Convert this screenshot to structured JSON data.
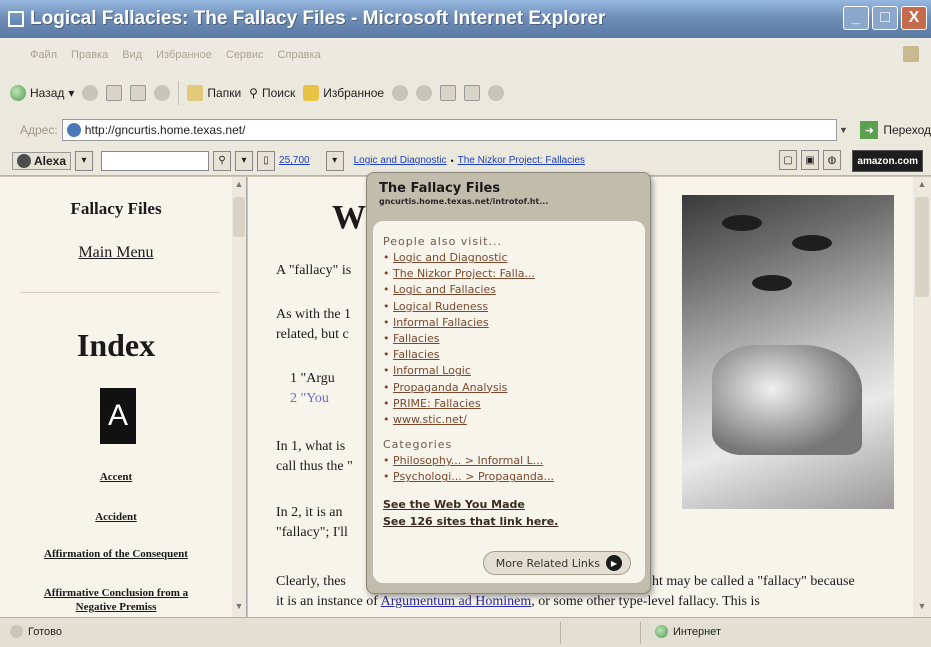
{
  "window": {
    "title": "Logical Fallacies: The Fallacy Files - Microsoft Internet Explorer",
    "buttons": [
      "_",
      "□",
      "X"
    ]
  },
  "menubar": {
    "items": [
      "Файл",
      "Правка",
      "Вид",
      "Избранное",
      "Сервис",
      "Справка"
    ]
  },
  "toolbar": {
    "back_label": "Назад",
    "folders_label": "Папки",
    "search_label": "Поиск",
    "favorites_label": "Избранное"
  },
  "address": {
    "label": "Адрес:",
    "url": "http://gncurtis.home.texas.net/",
    "go_label": "Переход"
  },
  "alexa": {
    "logo_label": "Alexa",
    "rank": "25,700",
    "related_links": [
      "Logic and Diagnostic",
      "The Nizkor Project: Fallacies"
    ],
    "amazon_label": "amazon.com"
  },
  "left_frame": {
    "site_title": "Fallacy Files",
    "main_menu": "Main Menu",
    "index_heading": "Index",
    "letter": "A",
    "links": [
      "Accent",
      "Accident",
      "Affirmation of the Consequent",
      "Affirmative Conclusion from a",
      "Negative Premiss"
    ]
  },
  "main_frame": {
    "heading_fragment": "W",
    "lines": [
      "A \"fallacy\" is",
      "As with the 1",
      "related, but c",
      "In 1, what is",
      "call thus the \"",
      "In 2, it is an",
      "\"fallacy\"; I'll",
      "Clearly, thes",
      "ht may be called a \"fallacy\" because"
    ],
    "list_items": [
      "1   \"Argu",
      "2   \"You"
    ],
    "last_line_prefix": "it is an instance of ",
    "last_line_link": "Argumentum ad Hominem",
    "last_line_suffix": ", or some other type-level fallacy. This is"
  },
  "popup": {
    "title": "The Fallacy Files",
    "url": "gncurtis.home.texas.net/introtof.ht...",
    "people_heading": "People also visit...",
    "people_links": [
      "Logic and Diagnostic",
      "The Nizkor Project: Falla...",
      "Logic and Fallacies",
      "Logical Rudeness",
      "Informal Fallacies",
      "Fallacies",
      "Fallacies",
      "Informal Logic",
      "Propaganda Analysis",
      "PRIME: Fallacies",
      "www.stic.net/"
    ],
    "categories_heading": "Categories",
    "category_links": [
      "Philosophy... > Informal L...",
      "Psychologi... > Propaganda..."
    ],
    "see_web": "See the Web You Made",
    "see_links": "See 126 sites that link here.",
    "more_button": "More Related Links"
  },
  "status": {
    "left": "Готово",
    "zone": "Интернет"
  }
}
